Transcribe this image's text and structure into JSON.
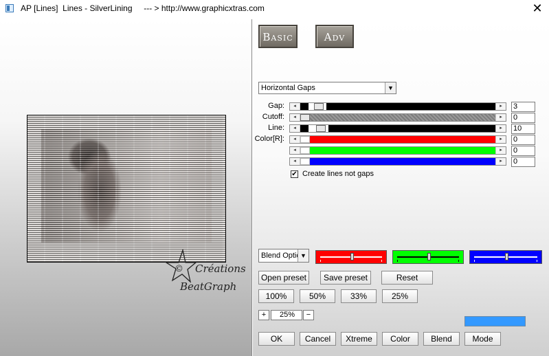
{
  "window": {
    "title": "AP [Lines]  Lines - SilverLining     --- > http://www.graphicxtras.com",
    "close_glyph": "✕"
  },
  "preview": {
    "watermark_line1": "Créations",
    "watermark_line2": "BeatGraph",
    "watermark_copyright": "©"
  },
  "tabs": {
    "basic": "Basic",
    "adv": "Adv"
  },
  "mode_select": {
    "value": "Horizontal Gaps"
  },
  "params": [
    {
      "label": "Gap:",
      "value": "3",
      "bar_color": "#000000",
      "thumb_fraction": 0.03
    },
    {
      "label": "Cutoff:",
      "value": "0",
      "bar_color": "#808080",
      "thumb_fraction": 0.0
    },
    {
      "label": "Line:",
      "value": "10",
      "bar_color": "#000000",
      "thumb_fraction": 0.04
    },
    {
      "label": "Color[R]:",
      "value": "0",
      "bar_color": "#ff0000",
      "thumb_fraction": 0.0
    },
    {
      "label": "",
      "value": "0",
      "bar_color": "#00ff00",
      "thumb_fraction": 0.0
    },
    {
      "label": "",
      "value": "0",
      "bar_color": "#0000ff",
      "thumb_fraction": 0.0
    }
  ],
  "checkbox": {
    "label": "Create lines not gaps",
    "checked": true,
    "mark": "✔"
  },
  "blend": {
    "select_value": "Blend Optic",
    "colors": [
      "#ff0000",
      "#00ff00",
      "#0000ff"
    ],
    "levels": [
      0.5,
      0.5,
      0.5
    ]
  },
  "preset_buttons": {
    "open": "Open preset",
    "save": "Save preset",
    "reset": "Reset"
  },
  "zoom_buttons": [
    "100%",
    "50%",
    "33%",
    "25%"
  ],
  "zoom": {
    "plus": "+",
    "minus": "−",
    "value": "25%"
  },
  "swatch_color": "#3399ff",
  "bottom_buttons": [
    "OK",
    "Cancel",
    "Xtreme",
    "Color",
    "Blend",
    "Mode"
  ]
}
